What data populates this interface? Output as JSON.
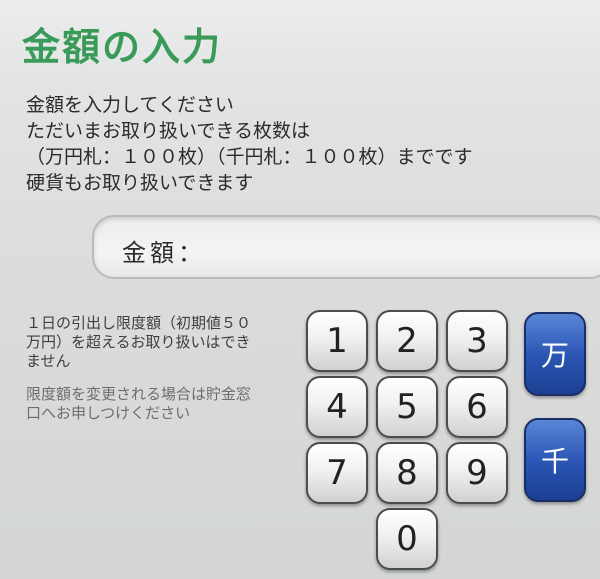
{
  "screen": {
    "title": "金額の入力",
    "instructions": [
      "金額を入力してください",
      "ただいまお取り扱いできる枚数は",
      "（万円札：１００枚）（千円札：１００枚）までです",
      "硬貨もお取り扱いできます"
    ]
  },
  "amount_field": {
    "label": "金額："
  },
  "notes": {
    "limit_text": "１日の引出し限度額（初期値５０万円）を超えるお取り扱いはできません",
    "change_text": "限度額を変更される場合は貯金窓口へお申しつけください"
  },
  "keypad": {
    "keys": [
      "1",
      "2",
      "3",
      "4",
      "5",
      "6",
      "7",
      "8",
      "9",
      "0"
    ],
    "unit_man": "万",
    "unit_sen": "千"
  },
  "colors": {
    "title_green": "#3a9a5a",
    "unit_key_blue": "#2c57b6"
  }
}
